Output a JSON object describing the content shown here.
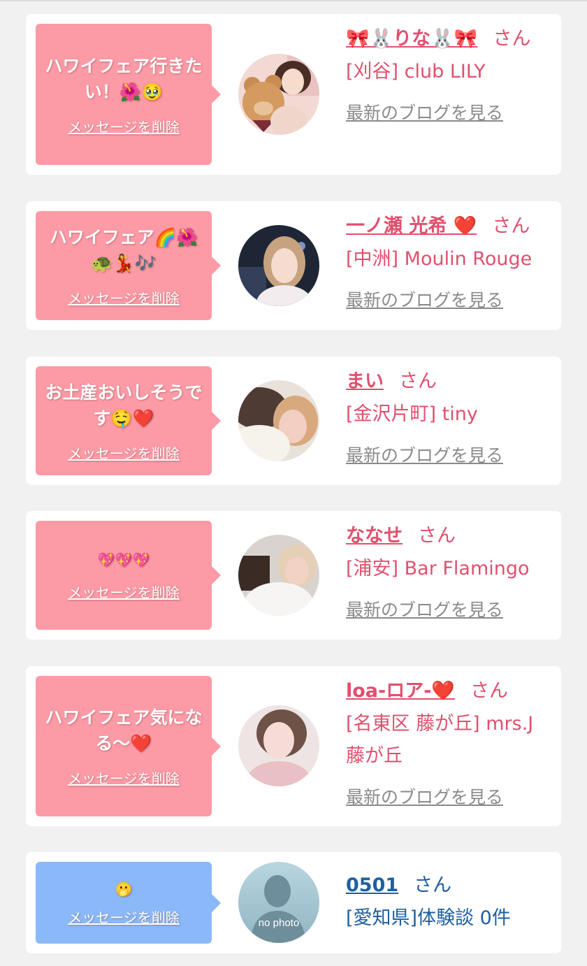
{
  "colors": {
    "page_background": "#f1f1f1",
    "card_background": "#ffffff",
    "bubble_pink": "#fc9aa6",
    "bubble_blue": "#8ab8f8",
    "name_pink": "#e0506e",
    "name_blue": "#1f5fa0",
    "blog_link_gray": "#8a8a8a"
  },
  "cards": [
    {
      "message": "ハワイフェア行きたい！🌺🥹",
      "delete_label": "メッセージを削除",
      "name": "🎀🐰りな🐰🎀",
      "honorific": "さん",
      "shop": "[刈谷] club LILY",
      "blog_link": "最新のブログを見る",
      "avatar_icon": "profile-photo-with-teddy-bear"
    },
    {
      "message": "ハワイフェア🌈🌺🐢💃🎶",
      "delete_label": "メッセージを削除",
      "name": "一ノ瀬 光希 ❤️",
      "honorific": "さん",
      "shop": "[中洲] Moulin Rouge",
      "blog_link": "最新のブログを見る",
      "avatar_icon": "profile-photo"
    },
    {
      "message": "お土産おいしそうです🤤❤️",
      "delete_label": "メッセージを削除",
      "name": "まい",
      "honorific": "さん",
      "shop": "[金沢片町] tiny",
      "blog_link": "最新のブログを見る",
      "avatar_icon": "profile-photo-blurred"
    },
    {
      "message": "💖💖💖",
      "delete_label": "メッセージを削除",
      "name": "ななせ",
      "honorific": "さん",
      "shop": "[浦安] Bar Flamingo",
      "blog_link": "最新のブログを見る",
      "avatar_icon": "profile-photo"
    },
    {
      "message": "ハワイフェア気になる〜❤️",
      "delete_label": "メッセージを削除",
      "name": "loa-ロア-❤️",
      "honorific": "さん",
      "shop": "[名東区 藤が丘] mrs.J 藤が丘",
      "blog_link": "最新のブログを見る",
      "avatar_icon": "profile-photo"
    },
    {
      "message": "🫢",
      "delete_label": "メッセージを削除",
      "name": "0501",
      "honorific": "さん",
      "shop": "[愛知県]体験談 0件",
      "avatar_icon": "no-photo-silhouette",
      "avatar_caption": "no photo"
    }
  ]
}
